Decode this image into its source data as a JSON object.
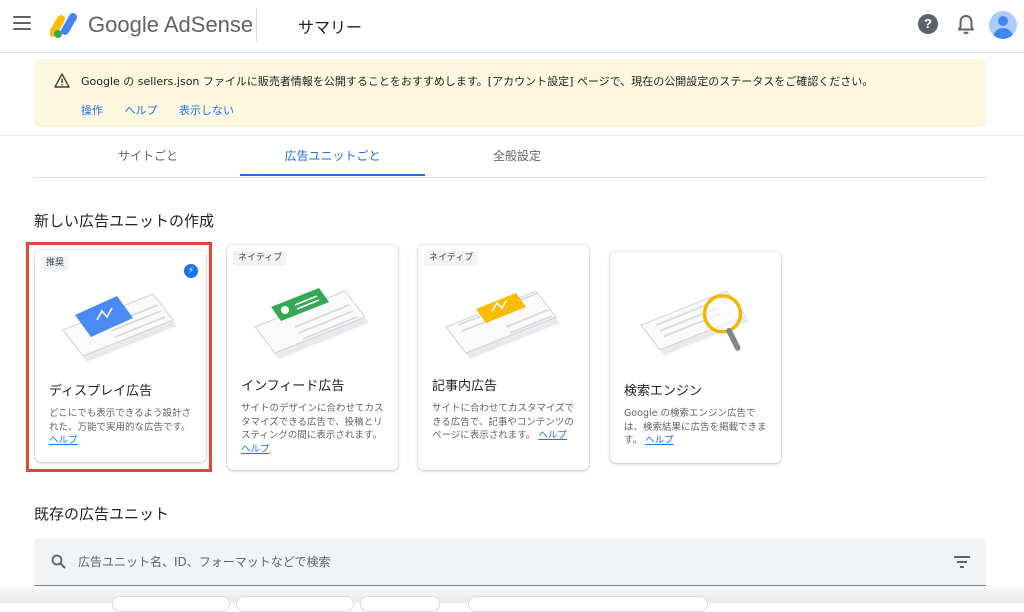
{
  "header": {
    "brand_google": "Google",
    "brand_product": "AdSense",
    "page_title": "サマリー",
    "help_glyph": "?"
  },
  "banner": {
    "message": "Google の sellers.json ファイルに販売者情報を公開することをおすすめします。[アカウント設定] ページで、現在の公開設定のステータスをご確認ください。",
    "actions": [
      "操作",
      "ヘルプ",
      "表示しない"
    ]
  },
  "tabs": [
    {
      "label": "サイトごと",
      "active": false
    },
    {
      "label": "広告ユニットごと",
      "active": true
    },
    {
      "label": "全般設定",
      "active": false
    }
  ],
  "create_section": {
    "title": "新しい広告ユニットの作成",
    "cards": [
      {
        "badge": "推奨",
        "title": "ディスプレイ広告",
        "description": "どこにでも表示できるよう設計された、万能で実用的な広告です。",
        "help": "ヘルプ",
        "highlighted": true
      },
      {
        "badge": "ネイティブ",
        "title": "インフィード広告",
        "description": "サイトのデザインに合わせてカスタマイズできる広告で、投稿とリスティングの間に表示されます。",
        "help": "ヘルプ",
        "highlighted": false
      },
      {
        "badge": "ネイティブ",
        "title": "記事内広告",
        "description": "サイトに合わせてカスタマイズできる広告で、記事やコンテンツのページに表示されます。",
        "help": "ヘルプ",
        "highlighted": false
      },
      {
        "badge": "",
        "title": "検索エンジン",
        "description": "Google の検索エンジン広告では、検索結果に広告を掲載できます。",
        "help": "ヘルプ",
        "highlighted": false
      }
    ]
  },
  "existing_section": {
    "title": "既存の広告ユニット",
    "search_placeholder": "広告ユニット名、ID、フォーマットなどで検索"
  },
  "colors": {
    "accent": "#1a73e8",
    "highlight_border": "#ea4335",
    "banner_bg": "#fef7e0",
    "display_ad": "#4a8af4",
    "infeed_ad": "#34a853",
    "inarticle_ad": "#fbbc04",
    "magnifier": "#f4b400"
  },
  "icons": {
    "menu": "menu-icon",
    "help": "help-icon",
    "notifications": "bell-icon",
    "warning": "warning-icon",
    "recommended": "bolt-icon",
    "search": "search-icon",
    "filter": "filter-icon"
  }
}
